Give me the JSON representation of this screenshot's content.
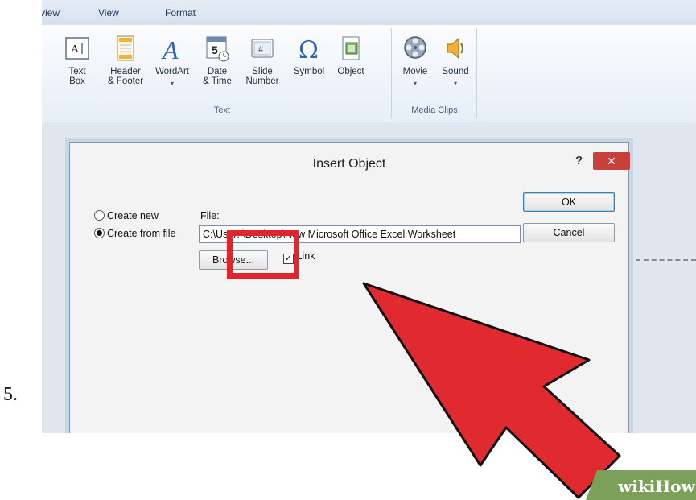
{
  "step_number": "5.",
  "ribbon": {
    "tabs": [
      "view",
      "View",
      "Format"
    ],
    "text_group": {
      "label": "Text",
      "buttons": [
        {
          "label": "Text\nBox",
          "icon": "text-box-icon"
        },
        {
          "label": "Header\n& Footer",
          "icon": "header-footer-icon"
        },
        {
          "label": "WordArt",
          "icon": "wordart-icon",
          "has_dropdown": true
        },
        {
          "label": "Date\n& Time",
          "icon": "date-time-icon"
        },
        {
          "label": "Slide\nNumber",
          "icon": "slide-number-icon"
        },
        {
          "label": "Symbol",
          "icon": "symbol-omega-icon"
        },
        {
          "label": "Object",
          "icon": "object-icon"
        }
      ]
    },
    "media_group": {
      "label": "Media Clips",
      "buttons": [
        {
          "label": "Movie",
          "icon": "movie-reel-icon",
          "has_dropdown": true
        },
        {
          "label": "Sound",
          "icon": "speaker-icon",
          "has_dropdown": true
        }
      ]
    }
  },
  "dialog": {
    "title": "Insert Object",
    "help": "?",
    "close": "✕",
    "create_new": "Create new",
    "create_from_file": "Create from file",
    "selected_option": "create_from_file",
    "file_label": "File:",
    "file_value": "C:\\User:          \\Desktop\\New Microsoft Office Excel Worksheet",
    "browse_label": "Browse...",
    "link_label": "Link",
    "link_checked": true,
    "ok_label": "OK",
    "cancel_label": "Cancel"
  },
  "brand": "wikiHow",
  "colors": {
    "highlight": "#e1252d",
    "arrow": "#e12a30",
    "close_button": "#c7413c",
    "brand_bg": "#7aa05a"
  }
}
